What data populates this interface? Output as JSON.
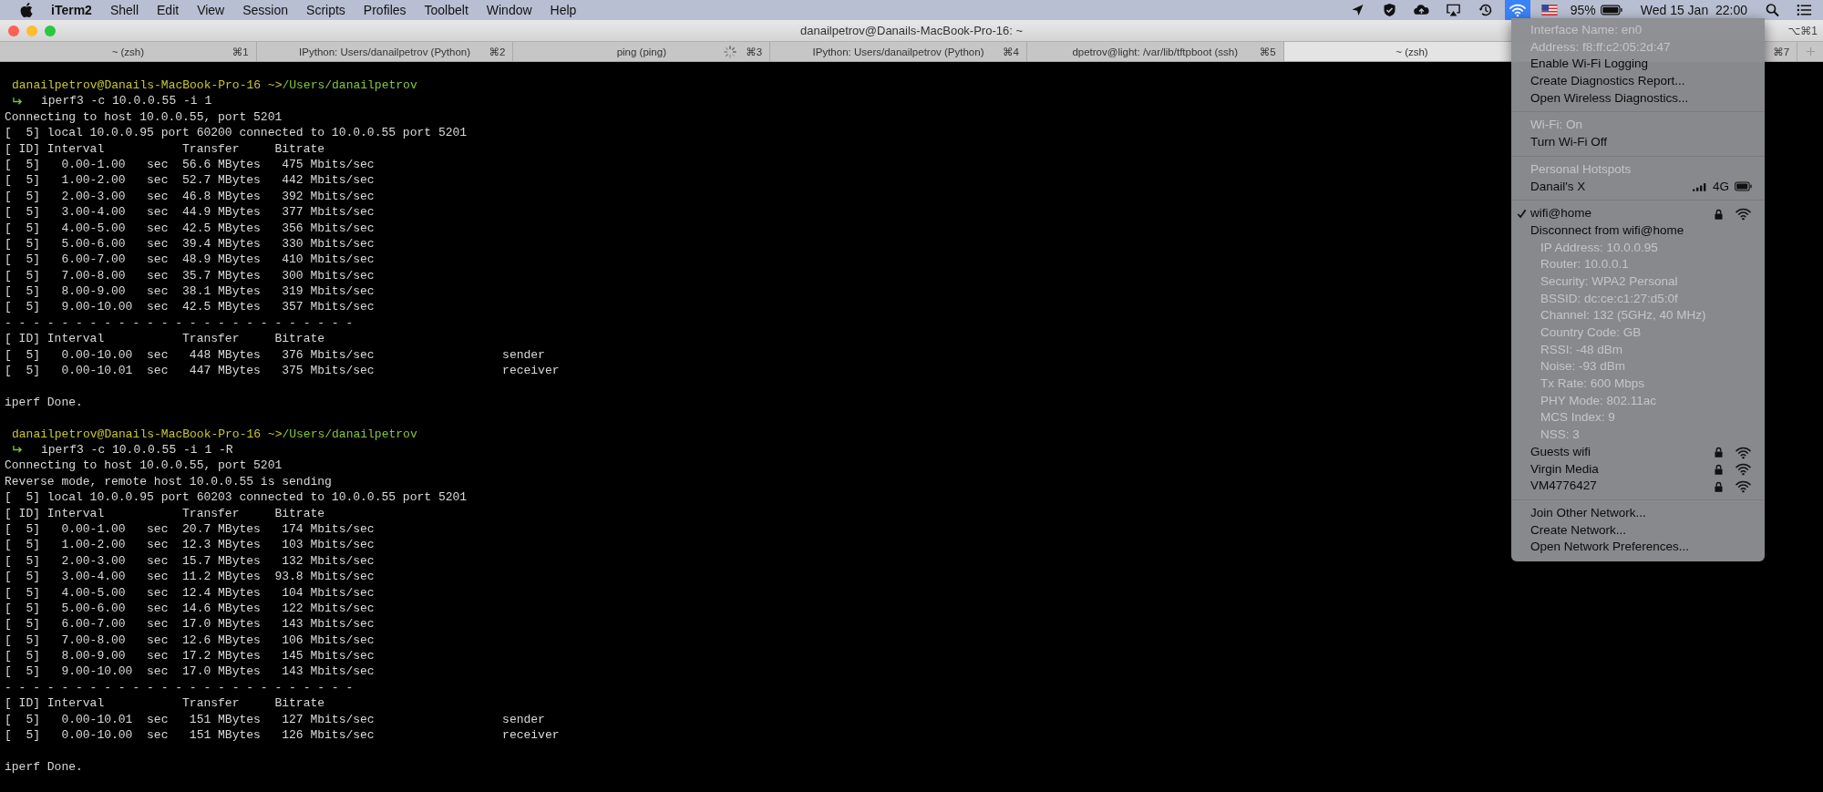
{
  "menu_bar": {
    "app_name": "iTerm2",
    "menus": [
      "Shell",
      "Edit",
      "View",
      "Session",
      "Scripts",
      "Profiles",
      "Toolbelt",
      "Window",
      "Help"
    ],
    "wifi_highlighted": true,
    "battery": "95%",
    "clock": "Wed 15 Jan  22:00"
  },
  "window": {
    "title": "danailpetrov@Danails-MacBook-Pro-16: ~",
    "shortcut": "⌥⌘1"
  },
  "tabs": [
    {
      "label": "~ (zsh)",
      "shortcut": "⌘1",
      "selected": false,
      "busy": false
    },
    {
      "label": "IPython: Users/danailpetrov (Python)",
      "shortcut": "⌘2",
      "selected": false,
      "busy": false
    },
    {
      "label": "ping (ping)",
      "shortcut": "⌘3",
      "selected": false,
      "busy": true
    },
    {
      "label": "IPython: Users/danailpetrov (Python)",
      "shortcut": "⌘4",
      "selected": false,
      "busy": false
    },
    {
      "label": "dpetrov@light: /var/lib/tftpboot (ssh)",
      "shortcut": "⌘5",
      "selected": false,
      "busy": false
    },
    {
      "label": "~ (zsh)",
      "selected": true,
      "busy": false
    },
    {
      "shortcut": "⌘7",
      "selected": false
    }
  ],
  "terminal": [
    {
      "kind": "prompt",
      "user": "danailpetrov@Danails-MacBook-Pro-16 ~>",
      "path": "/Users/danailpetrov"
    },
    {
      "kind": "command",
      "text": "iperf3 -c 10.0.0.55 -i 1"
    },
    {
      "kind": "output",
      "text": "Connecting to host 10.0.0.55, port 5201"
    },
    {
      "kind": "output",
      "text": "[  5] local 10.0.0.95 port 60200 connected to 10.0.0.55 port 5201"
    },
    {
      "kind": "output",
      "text": "[ ID] Interval           Transfer     Bitrate"
    },
    {
      "kind": "output",
      "text": "[  5]   0.00-1.00   sec  56.6 MBytes   475 Mbits/sec"
    },
    {
      "kind": "output",
      "text": "[  5]   1.00-2.00   sec  52.7 MBytes   442 Mbits/sec"
    },
    {
      "kind": "output",
      "text": "[  5]   2.00-3.00   sec  46.8 MBytes   392 Mbits/sec"
    },
    {
      "kind": "output",
      "text": "[  5]   3.00-4.00   sec  44.9 MBytes   377 Mbits/sec"
    },
    {
      "kind": "output",
      "text": "[  5]   4.00-5.00   sec  42.5 MBytes   356 Mbits/sec"
    },
    {
      "kind": "output",
      "text": "[  5]   5.00-6.00   sec  39.4 MBytes   330 Mbits/sec"
    },
    {
      "kind": "output",
      "text": "[  5]   6.00-7.00   sec  48.9 MBytes   410 Mbits/sec"
    },
    {
      "kind": "output",
      "text": "[  5]   7.00-8.00   sec  35.7 MBytes   300 Mbits/sec"
    },
    {
      "kind": "output",
      "text": "[  5]   8.00-9.00   sec  38.1 MBytes   319 Mbits/sec"
    },
    {
      "kind": "output",
      "text": "[  5]   9.00-10.00  sec  42.5 MBytes   357 Mbits/sec"
    },
    {
      "kind": "output",
      "text": "- - - - - - - - - - - - - - - - - - - - - - - - -"
    },
    {
      "kind": "output",
      "text": "[ ID] Interval           Transfer     Bitrate"
    },
    {
      "kind": "output",
      "text": "[  5]   0.00-10.00  sec   448 MBytes   376 Mbits/sec                  sender"
    },
    {
      "kind": "output",
      "text": "[  5]   0.00-10.01  sec   447 MBytes   375 Mbits/sec                  receiver"
    },
    {
      "kind": "blank"
    },
    {
      "kind": "output",
      "text": "iperf Done."
    },
    {
      "kind": "blank"
    },
    {
      "kind": "prompt",
      "user": "danailpetrov@Danails-MacBook-Pro-16 ~>",
      "path": "/Users/danailpetrov"
    },
    {
      "kind": "command",
      "text": "iperf3 -c 10.0.0.55 -i 1 -R"
    },
    {
      "kind": "output",
      "text": "Connecting to host 10.0.0.55, port 5201"
    },
    {
      "kind": "output",
      "text": "Reverse mode, remote host 10.0.0.55 is sending"
    },
    {
      "kind": "output",
      "text": "[  5] local 10.0.0.95 port 60203 connected to 10.0.0.55 port 5201"
    },
    {
      "kind": "output",
      "text": "[ ID] Interval           Transfer     Bitrate"
    },
    {
      "kind": "output",
      "text": "[  5]   0.00-1.00   sec  20.7 MBytes   174 Mbits/sec"
    },
    {
      "kind": "output",
      "text": "[  5]   1.00-2.00   sec  12.3 MBytes   103 Mbits/sec"
    },
    {
      "kind": "output",
      "text": "[  5]   2.00-3.00   sec  15.7 MBytes   132 Mbits/sec"
    },
    {
      "kind": "output",
      "text": "[  5]   3.00-4.00   sec  11.2 MBytes  93.8 Mbits/sec"
    },
    {
      "kind": "output",
      "text": "[  5]   4.00-5.00   sec  12.4 MBytes   104 Mbits/sec"
    },
    {
      "kind": "output",
      "text": "[  5]   5.00-6.00   sec  14.6 MBytes   122 Mbits/sec"
    },
    {
      "kind": "output",
      "text": "[  5]   6.00-7.00   sec  17.0 MBytes   143 Mbits/sec"
    },
    {
      "kind": "output",
      "text": "[  5]   7.00-8.00   sec  12.6 MBytes   106 Mbits/sec"
    },
    {
      "kind": "output",
      "text": "[  5]   8.00-9.00   sec  17.2 MBytes   145 Mbits/sec"
    },
    {
      "kind": "output",
      "text": "[  5]   9.00-10.00  sec  17.0 MBytes   143 Mbits/sec"
    },
    {
      "kind": "output",
      "text": "- - - - - - - - - - - - - - - - - - - - - - - - -"
    },
    {
      "kind": "output",
      "text": "[ ID] Interval           Transfer     Bitrate"
    },
    {
      "kind": "output",
      "text": "[  5]   0.00-10.01  sec   151 MBytes   127 Mbits/sec                  sender"
    },
    {
      "kind": "output",
      "text": "[  5]   0.00-10.00  sec   151 MBytes   126 Mbits/sec                  receiver"
    },
    {
      "kind": "blank"
    },
    {
      "kind": "output",
      "text": "iperf Done."
    }
  ],
  "wifi_menu": [
    [
      {
        "kind": "item",
        "label": "Interface Name: en0",
        "disabled": true
      },
      {
        "kind": "item",
        "label": "Address: f8:ff:c2:05:2d:47",
        "disabled": true
      },
      {
        "kind": "item",
        "label": "Enable Wi-Fi Logging",
        "disabled": false
      },
      {
        "kind": "item",
        "label": "Create Diagnostics Report...",
        "disabled": false
      },
      {
        "kind": "item",
        "label": "Open Wireless Diagnostics...",
        "disabled": false
      }
    ],
    [
      {
        "kind": "item",
        "label": "Wi-Fi: On",
        "disabled": true
      },
      {
        "kind": "item",
        "label": "Turn Wi-Fi Off",
        "disabled": false
      }
    ],
    [
      {
        "kind": "item",
        "label": "Personal Hotspots",
        "disabled": true
      },
      {
        "kind": "hotspot",
        "label": "Danail's X",
        "network_type": "4G",
        "disabled": false
      }
    ],
    [
      {
        "kind": "network",
        "label": "wifi@home",
        "checked": true,
        "locked": true
      },
      {
        "kind": "item",
        "label": "Disconnect from wifi@home",
        "disabled": false
      },
      {
        "kind": "detail",
        "label": "IP Address: 10.0.0.95",
        "disabled": true
      },
      {
        "kind": "detail",
        "label": "Router: 10.0.0.1",
        "disabled": true
      },
      {
        "kind": "detail",
        "label": "Security: WPA2 Personal",
        "disabled": true
      },
      {
        "kind": "detail",
        "label": "BSSID: dc:ce:c1:27:d5:0f",
        "disabled": true
      },
      {
        "kind": "detail",
        "label": "Channel: 132 (5GHz, 40 MHz)",
        "disabled": true
      },
      {
        "kind": "detail",
        "label": "Country Code: GB",
        "disabled": true
      },
      {
        "kind": "detail",
        "label": "RSSI: -48 dBm",
        "disabled": true
      },
      {
        "kind": "detail",
        "label": "Noise: -93 dBm",
        "disabled": true
      },
      {
        "kind": "detail",
        "label": "Tx Rate: 600 Mbps",
        "disabled": true
      },
      {
        "kind": "detail",
        "label": "PHY Mode: 802.11ac",
        "disabled": true
      },
      {
        "kind": "detail",
        "label": "MCS Index: 9",
        "disabled": true
      },
      {
        "kind": "detail",
        "label": "NSS: 3",
        "disabled": true
      },
      {
        "kind": "network",
        "label": "Guests wifi",
        "checked": false,
        "locked": true
      },
      {
        "kind": "network",
        "label": "Virgin Media",
        "checked": false,
        "locked": true
      },
      {
        "kind": "network",
        "label": "VM4776427",
        "checked": false,
        "locked": true
      }
    ],
    [
      {
        "kind": "item",
        "label": "Join Other Network...",
        "disabled": false
      },
      {
        "kind": "item",
        "label": "Create Network...",
        "disabled": false
      },
      {
        "kind": "item",
        "label": "Open Network Preferences...",
        "disabled": false
      }
    ]
  ]
}
